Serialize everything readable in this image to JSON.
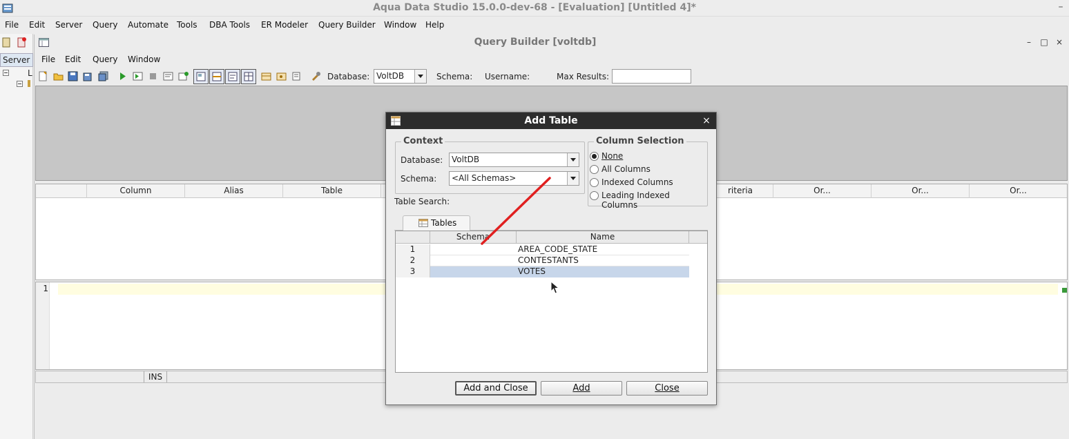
{
  "app": {
    "title": "Aqua Data Studio 15.0.0-dev-68 - [Evaluation] [Untitled 4]*",
    "minimize_glyph": "–"
  },
  "main_menu": [
    "File",
    "Edit",
    "Server",
    "Query",
    "Automate",
    "Tools",
    "DBA Tools",
    "ER Modeler",
    "Query Builder",
    "Window",
    "Help"
  ],
  "left_panel": {
    "tab_label": "Server",
    "tree_glyph": "L"
  },
  "query_builder": {
    "title": "Query Builder [voltdb]",
    "controls": {
      "minimize": "–",
      "maximize": "□",
      "close": "×"
    },
    "menu": [
      "File",
      "Edit",
      "Query",
      "Window"
    ],
    "toolbar": {
      "database_label": "Database:",
      "database_value": "VoltDB",
      "schema_label": "Schema:",
      "username_label": "Username:",
      "max_results_label": "Max Results:",
      "max_results_value": ""
    },
    "grid_columns": [
      "",
      "Column",
      "Alias",
      "Table",
      "",
      "",
      "",
      "",
      "",
      "",
      "riteria",
      "Or...",
      "Or...",
      "Or..."
    ],
    "editor": {
      "line_number": "1"
    },
    "status": {
      "mode": "INS"
    }
  },
  "dialog": {
    "title": "Add Table",
    "close_glyph": "×",
    "context": {
      "legend": "Context",
      "database_label": "Database:",
      "database_value": "VoltDB",
      "schema_label": "Schema:",
      "schema_value": "<All Schemas>"
    },
    "column_selection": {
      "legend": "Column Selection",
      "options": [
        "None",
        "All Columns",
        "Indexed Columns",
        "Leading Indexed Columns"
      ],
      "selected": "None"
    },
    "table_search_label": "Table Search:",
    "tab_label": "Tables",
    "table": {
      "headers": [
        "",
        "Schema",
        "Name"
      ],
      "rows": [
        {
          "num": "1",
          "schema": "",
          "name": "AREA_CODE_STATE"
        },
        {
          "num": "2",
          "schema": "",
          "name": "CONTESTANTS"
        },
        {
          "num": "3",
          "schema": "",
          "name": "VOTES"
        }
      ],
      "selected_row": "3"
    },
    "buttons": {
      "add_and_close": "Add and Close",
      "add": "Add",
      "close": "Close"
    }
  },
  "colors": {
    "dialog_title_bg": "#2c2c2c",
    "selection_bg": "#c7d6ea",
    "annotation_red": "#e02020",
    "diagram_bg": "#c6c6c6"
  }
}
